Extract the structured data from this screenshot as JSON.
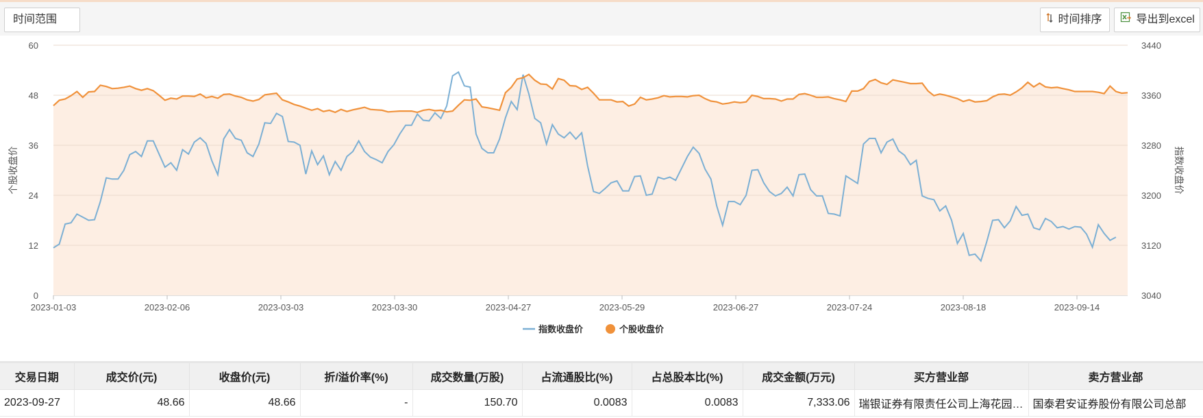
{
  "toolbar": {
    "range_label": "时间范围",
    "sort_label": "时间排序",
    "export_label": "导出到excel",
    "sort_icon": "sort-arrows-icon",
    "export_icon": "excel-icon"
  },
  "chart_data": {
    "type": "line",
    "x_ticks": [
      "2023-01-03",
      "2023-02-06",
      "2023-03-03",
      "2023-03-30",
      "2023-04-27",
      "2023-05-29",
      "2023-06-27",
      "2023-07-24",
      "2023-08-18",
      "2023-09-14"
    ],
    "y_left": {
      "label": "个股收盘价",
      "range": [
        0,
        60
      ],
      "ticks": [
        0,
        12,
        24,
        36,
        48,
        60
      ]
    },
    "y_right": {
      "label": "指数收盘价",
      "range": [
        3040,
        3440
      ],
      "ticks": [
        3040,
        3120,
        3200,
        3280,
        3360,
        3440
      ]
    },
    "grid": true,
    "legend_position": "bottom-center",
    "colors": {
      "index": "#7bafd4",
      "stock": "#f0913a",
      "area": "#fdeee3"
    },
    "series": [
      {
        "name": "指数收盘价",
        "axis": "right",
        "values": [
          3116,
          3122,
          3154,
          3156,
          3170,
          3165,
          3160,
          3161,
          3190,
          3228,
          3226,
          3226,
          3240,
          3265,
          3270,
          3262,
          3287,
          3287,
          3266,
          3245,
          3252,
          3240,
          3273,
          3266,
          3285,
          3292,
          3283,
          3255,
          3233,
          3290,
          3305,
          3291,
          3288,
          3268,
          3262,
          3282,
          3316,
          3315,
          3331,
          3326,
          3286,
          3285,
          3280,
          3234,
          3271,
          3249,
          3263,
          3233,
          3254,
          3240,
          3262,
          3270,
          3287,
          3270,
          3261,
          3257,
          3252,
          3270,
          3281,
          3298,
          3312,
          3312,
          3330,
          3320,
          3319,
          3332,
          3323,
          3343,
          3391,
          3397,
          3375,
          3373,
          3298,
          3275,
          3268,
          3268,
          3290,
          3324,
          3350,
          3337,
          3393,
          3362,
          3323,
          3316,
          3282,
          3313,
          3298,
          3292,
          3301,
          3290,
          3300,
          3247,
          3206,
          3203,
          3211,
          3220,
          3223,
          3207,
          3207,
          3230,
          3231,
          3200,
          3202,
          3229,
          3226,
          3229,
          3224,
          3243,
          3262,
          3277,
          3267,
          3242,
          3226,
          3183,
          3152,
          3190,
          3190,
          3185,
          3200,
          3240,
          3241,
          3220,
          3206,
          3199,
          3203,
          3213,
          3199,
          3233,
          3234,
          3209,
          3199,
          3199,
          3171,
          3170,
          3167,
          3231,
          3225,
          3219,
          3282,
          3291,
          3291,
          3268,
          3285,
          3290,
          3271,
          3264,
          3249,
          3256,
          3199,
          3195,
          3193,
          3175,
          3183,
          3160,
          3123,
          3139,
          3104,
          3106,
          3095,
          3126,
          3160,
          3161,
          3148,
          3159,
          3182,
          3168,
          3170,
          3148,
          3145,
          3163,
          3158,
          3148,
          3150,
          3146,
          3150,
          3149,
          3138,
          3117,
          3153,
          3139,
          3128,
          3133
        ],
        "color": "#7bafd4"
      },
      {
        "name": "个股收盘价",
        "axis": "left",
        "values": [
          45.5,
          46.8,
          47.1,
          47.9,
          48.9,
          47.5,
          48.8,
          48.9,
          50.4,
          50.1,
          49.6,
          49.7,
          49.9,
          50.2,
          49.6,
          49.2,
          49.6,
          49.1,
          48.0,
          46.8,
          47.3,
          47.1,
          47.8,
          47.8,
          47.7,
          48.3,
          47.4,
          47.7,
          47.3,
          48.2,
          48.3,
          47.8,
          47.5,
          46.9,
          46.6,
          47.0,
          48.1,
          48.3,
          48.5,
          46.9,
          46.4,
          45.8,
          45.4,
          44.9,
          44.4,
          44.8,
          44.1,
          44.4,
          43.9,
          44.6,
          44.1,
          44.5,
          44.8,
          45.1,
          44.6,
          44.5,
          44.4,
          44.0,
          44.1,
          44.2,
          44.2,
          44.2,
          43.9,
          44.4,
          44.6,
          44.3,
          44.4,
          44.0,
          44.2,
          45.6,
          46.9,
          46.8,
          47.1,
          45.2,
          45.0,
          44.7,
          44.4,
          48.6,
          49.9,
          51.9,
          52.2,
          53.0,
          51.6,
          50.7,
          50.6,
          49.5,
          52.0,
          51.6,
          50.3,
          50.2,
          49.4,
          49.9,
          48.5,
          46.9,
          46.9,
          46.9,
          46.4,
          46.5,
          45.4,
          45.9,
          47.5,
          46.9,
          47.1,
          47.4,
          47.9,
          47.6,
          47.7,
          47.7,
          47.6,
          47.9,
          48.0,
          47.2,
          46.6,
          46.4,
          45.9,
          46.1,
          46.4,
          46.2,
          46.4,
          48.0,
          47.7,
          47.2,
          47.2,
          47.1,
          46.6,
          47.1,
          47.1,
          48.2,
          48.4,
          48.0,
          47.5,
          47.5,
          47.6,
          47.2,
          46.9,
          46.5,
          49.0,
          49.0,
          49.6,
          51.3,
          51.8,
          51.0,
          50.6,
          51.7,
          51.4,
          51.1,
          50.8,
          50.8,
          50.9,
          49.0,
          47.9,
          48.3,
          48.0,
          47.6,
          47.2,
          46.5,
          46.9,
          46.4,
          46.5,
          46.7,
          47.6,
          48.2,
          48.3,
          48.0,
          48.8,
          49.8,
          51.1,
          50.0,
          50.9,
          50.0,
          49.8,
          49.9,
          49.6,
          49.3,
          48.9,
          48.9,
          48.9,
          48.9,
          48.7,
          48.4,
          50.2,
          48.9,
          48.5,
          48.6
        ],
        "color": "#f0913a"
      }
    ]
  },
  "table": {
    "headers": [
      "交易日期",
      "成交价(元)",
      "收盘价(元)",
      "折/溢价率(%)",
      "成交数量(万股)",
      "占流通股比(%)",
      "占总股本比(%)",
      "成交金额(万元)",
      "买方营业部",
      "卖方营业部"
    ],
    "rows": [
      [
        "2023-09-27",
        "48.66",
        "48.66",
        "-",
        "150.70",
        "0.0083",
        "0.0083",
        "7,333.06",
        "瑞银证券有限责任公司上海花园石桥路证券营业部",
        "国泰君安证券股份有限公司总部"
      ]
    ]
  }
}
